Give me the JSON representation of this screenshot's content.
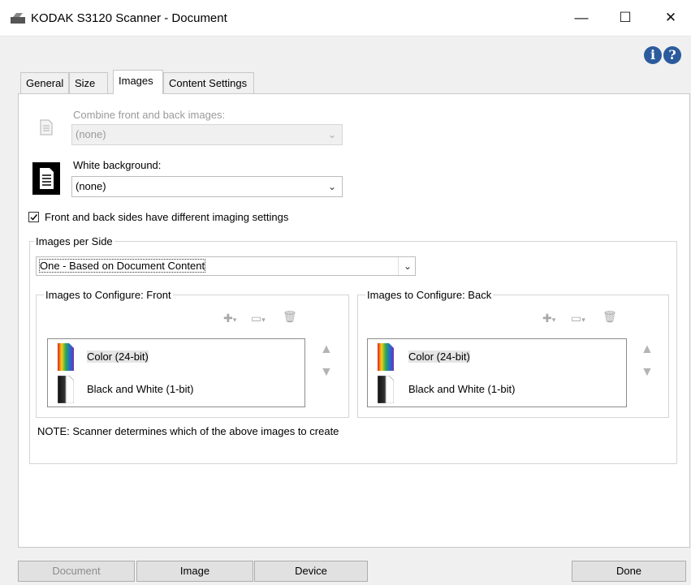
{
  "window": {
    "title": "KODAK S3120 Scanner - Document",
    "minimize": "—",
    "maximize": "☐",
    "close": "✕"
  },
  "help": {
    "info": "i",
    "help": "?"
  },
  "tabs": [
    {
      "label": "General"
    },
    {
      "label": "Size"
    },
    {
      "label": "Images"
    },
    {
      "label": "Content Settings"
    }
  ],
  "combine": {
    "label": "Combine front and back images:",
    "value": "(none)"
  },
  "white_background": {
    "label": "White background:",
    "value": "(none)"
  },
  "different_settings": {
    "label": "Front and back sides have different imaging settings",
    "checked": true
  },
  "images_per_side": {
    "title": "Images per Side",
    "value": "One - Based on Document Content"
  },
  "front": {
    "title": "Images to Configure: Front",
    "items": [
      {
        "label": "Color (24-bit)",
        "icon": "color-image-icon"
      },
      {
        "label": "Black and White (1-bit)",
        "icon": "bw-image-icon"
      }
    ]
  },
  "back": {
    "title": "Images to Configure: Back",
    "items": [
      {
        "label": "Color (24-bit)",
        "icon": "color-image-icon"
      },
      {
        "label": "Black and White (1-bit)",
        "icon": "bw-image-icon"
      }
    ]
  },
  "note": "NOTE: Scanner determines which of the above images to create",
  "bottom": {
    "document": "Document",
    "image": "Image",
    "device": "Device",
    "done": "Done"
  }
}
